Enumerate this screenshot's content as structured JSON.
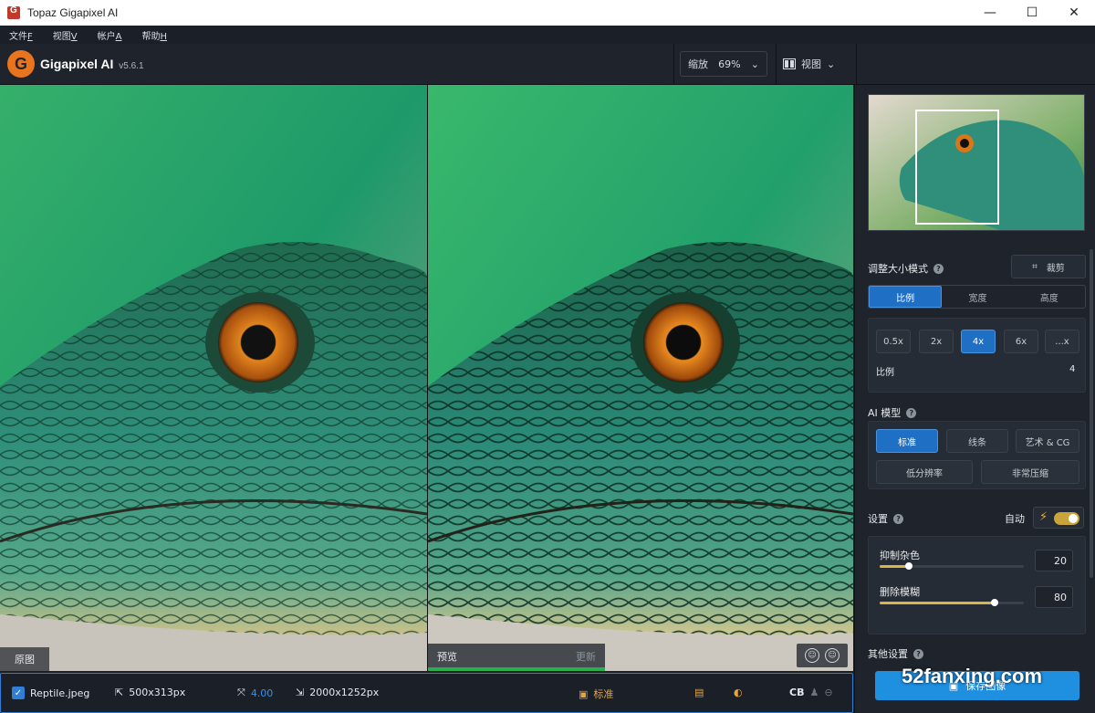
{
  "window": {
    "title": "Topaz Gigapixel AI",
    "minimize": "—",
    "maximize": "☐",
    "close": "✕"
  },
  "menu": [
    {
      "label": "文件",
      "key": "F"
    },
    {
      "label": "视图",
      "key": "V"
    },
    {
      "label": "帐户",
      "key": "A"
    },
    {
      "label": "帮助",
      "key": "H"
    }
  ],
  "header": {
    "brand": "Gigapixel AI",
    "version": "v5.6.1",
    "zoom_label": "缩放",
    "zoom_value": "69%",
    "view_label": "视图"
  },
  "panes": {
    "original_label": "原图",
    "preview_label": "预览",
    "update_label": "更新"
  },
  "status": {
    "filename": "Reptile.jpeg",
    "input_size": "500x313px",
    "scale": "4.00",
    "output_size": "2000x1252px",
    "model": "标准",
    "cb": "CB"
  },
  "sidebar": {
    "resize_mode_title": "调整大小模式",
    "crop_label": "裁剪",
    "resize_tabs": [
      "比例",
      "宽度",
      "高度"
    ],
    "scale_options": [
      "0.5x",
      "2x",
      "4x",
      "6x",
      "...x"
    ],
    "scale_label": "比例",
    "scale_value": "4",
    "ai_model_title": "AI 模型",
    "models_row1": [
      "标准",
      "线条",
      "艺术 & CG"
    ],
    "models_row2": [
      "低分辨率",
      "非常压缩"
    ],
    "settings_title": "设置",
    "auto_label": "自动",
    "noise_label": "抑制杂色",
    "noise_value": "20",
    "noise_level": 0.2,
    "blur_label": "删除模糊",
    "blur_value": "80",
    "blur_level": 0.8,
    "other_settings": "其他设置",
    "save_label": "保存图像"
  },
  "watermark": "52fanxing.com",
  "colors": {
    "accent": "#1f6fc5",
    "brand": "#e8741e",
    "status_border": "#2f7ed8"
  }
}
